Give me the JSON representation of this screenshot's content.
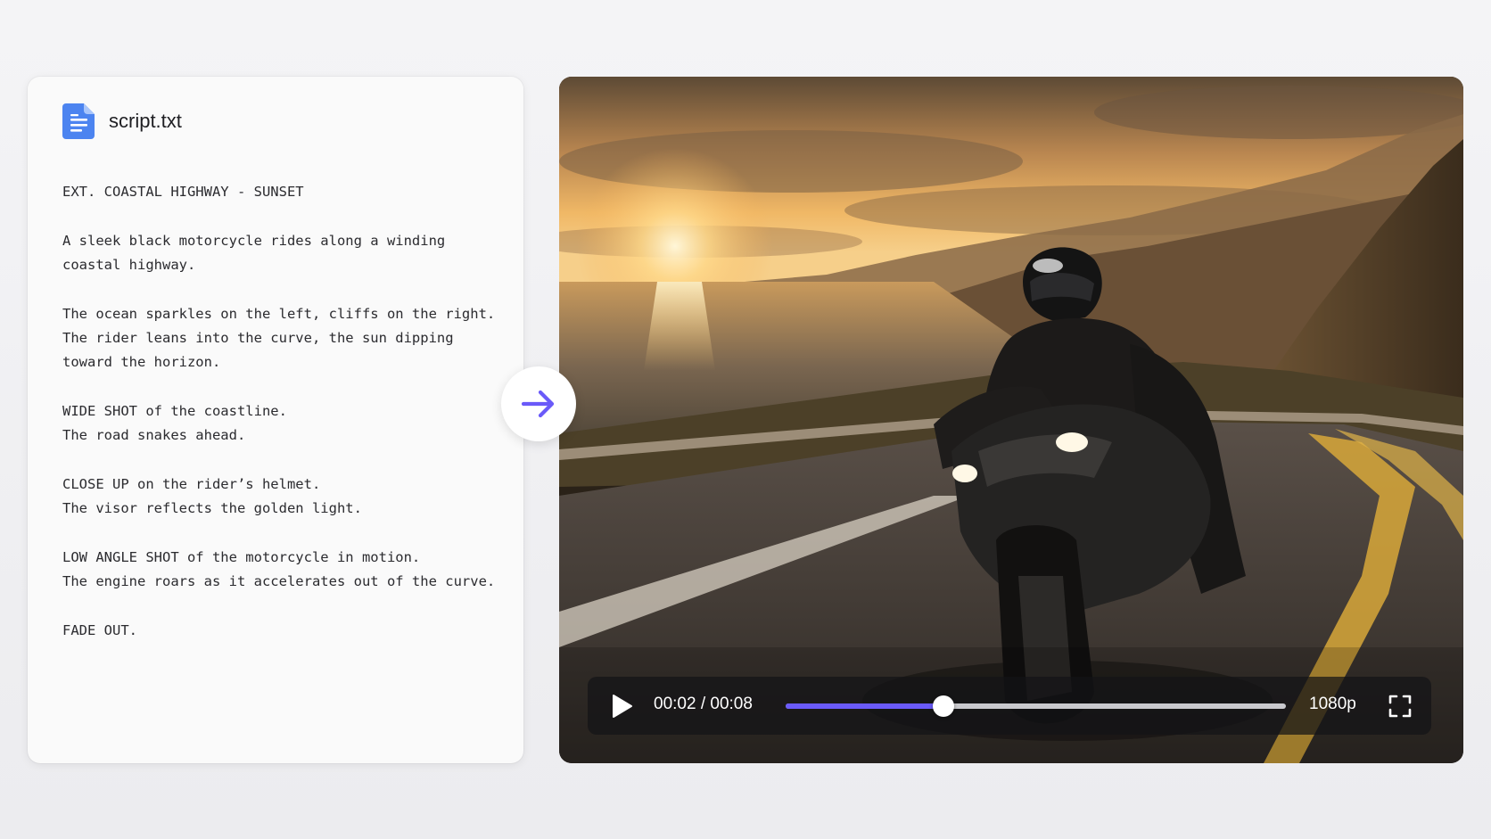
{
  "file": {
    "name": "script.txt",
    "icon": "document-icon",
    "icon_color": "#4c84f0"
  },
  "script": {
    "blocks": [
      [
        "EXT. COASTAL HIGHWAY - SUNSET"
      ],
      [
        "A sleek black motorcycle rides along a winding",
        "coastal highway."
      ],
      [
        "The ocean sparkles on the left, cliffs on the right.",
        "The rider leans into the curve, the sun dipping",
        "toward the horizon."
      ],
      [
        "WIDE SHOT of the coastline.",
        "The road snakes ahead."
      ],
      [
        "CLOSE UP on the rider’s helmet.",
        "The visor reflects the golden light."
      ],
      [
        "LOW ANGLE SHOT of the motorcycle in motion.",
        "The engine roars as it accelerates out of the curve."
      ],
      [
        "FADE OUT."
      ]
    ]
  },
  "connector": {
    "icon": "arrow-right-icon",
    "color": "#6a5af9"
  },
  "player": {
    "current_time": "00:02",
    "separator": " / ",
    "total_time": "00:08",
    "progress_percent": 31.5,
    "quality": "1080p",
    "accent_color": "#6a5af9",
    "play_icon": "play-icon",
    "fullscreen_icon": "fullscreen-icon"
  }
}
